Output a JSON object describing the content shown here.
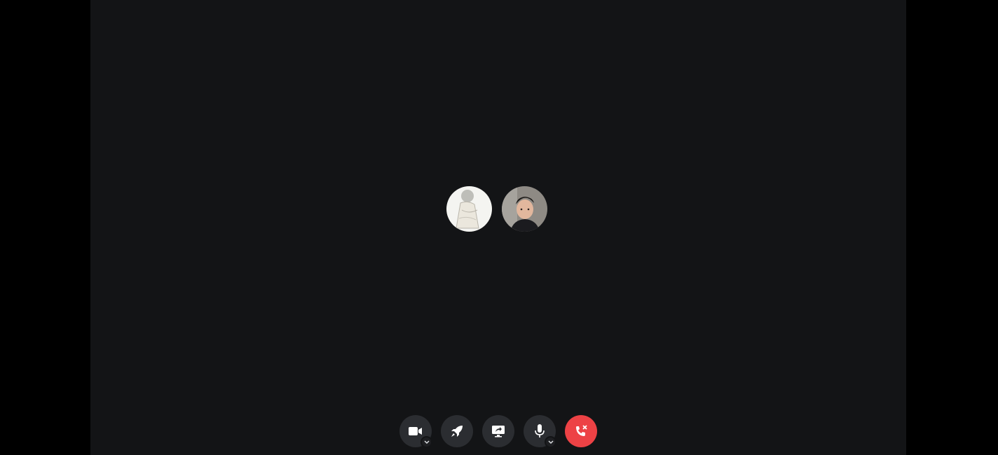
{
  "call": {
    "participants": [
      {
        "avatar": "sketch-illustration-avatar"
      },
      {
        "avatar": "young-man-photo-avatar"
      }
    ]
  },
  "controls": {
    "buttons": [
      {
        "icon": "video-camera-icon",
        "has_menu": true
      },
      {
        "icon": "rocket-icon",
        "has_menu": false
      },
      {
        "icon": "screen-share-icon",
        "has_menu": false
      },
      {
        "icon": "microphone-icon",
        "has_menu": true
      },
      {
        "icon": "end-call-icon",
        "has_menu": false
      }
    ]
  },
  "colors": {
    "background": "#131416",
    "letterbox": "#000000",
    "control_bg": "#2b2d31",
    "end_call": "#ed4245"
  }
}
